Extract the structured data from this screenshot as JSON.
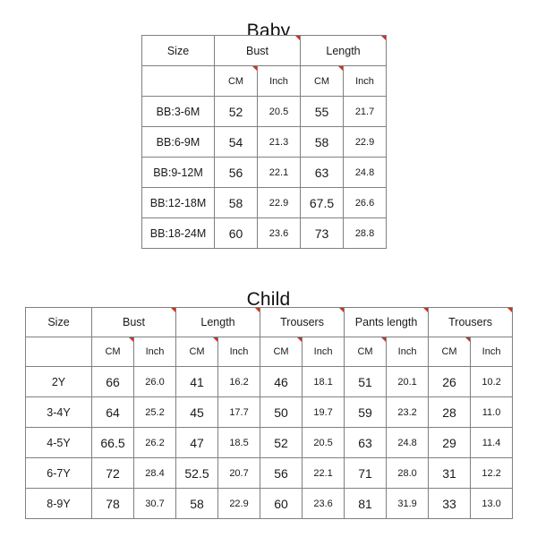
{
  "baby": {
    "title": "Baby",
    "header": {
      "size_label": "Size",
      "groups": [
        "Bust",
        "Length"
      ],
      "units": [
        "CM",
        "Inch",
        "CM",
        "Inch"
      ]
    },
    "rows": [
      {
        "size": "BB:3-6M",
        "cells": [
          "52",
          "20.5",
          "55",
          "21.7"
        ]
      },
      {
        "size": "BB:6-9M",
        "cells": [
          "54",
          "21.3",
          "58",
          "22.9"
        ]
      },
      {
        "size": "BB:9-12M",
        "cells": [
          "56",
          "22.1",
          "63",
          "24.8"
        ]
      },
      {
        "size": "BB:12-18M",
        "cells": [
          "58",
          "22.9",
          "67.5",
          "26.6"
        ]
      },
      {
        "size": "BB:18-24M",
        "cells": [
          "60",
          "23.6",
          "73",
          "28.8"
        ]
      }
    ]
  },
  "child": {
    "title": "Child",
    "header": {
      "size_label": "Size",
      "groups": [
        "Bust",
        "Length",
        "Trousers",
        "Pants length",
        "Trousers"
      ],
      "units": [
        "CM",
        "Inch",
        "CM",
        "Inch",
        "CM",
        "Inch",
        "CM",
        "Inch",
        "CM",
        "Inch"
      ]
    },
    "rows": [
      {
        "size": "2Y",
        "cells": [
          "66",
          "26.0",
          "41",
          "16.2",
          "46",
          "18.1",
          "51",
          "20.1",
          "26",
          "10.2"
        ]
      },
      {
        "size": "3-4Y",
        "cells": [
          "64",
          "25.2",
          "45",
          "17.7",
          "50",
          "19.7",
          "59",
          "23.2",
          "28",
          "11.0"
        ]
      },
      {
        "size": "4-5Y",
        "cells": [
          "66.5",
          "26.2",
          "47",
          "18.5",
          "52",
          "20.5",
          "63",
          "24.8",
          "29",
          "11.4"
        ]
      },
      {
        "size": "6-7Y",
        "cells": [
          "72",
          "28.4",
          "52.5",
          "20.7",
          "56",
          "22.1",
          "71",
          "28.0",
          "31",
          "12.2"
        ]
      },
      {
        "size": "8-9Y",
        "cells": [
          "78",
          "30.7",
          "58",
          "22.9",
          "60",
          "23.6",
          "81",
          "31.9",
          "33",
          "13.0"
        ]
      }
    ]
  },
  "colors": {
    "marker": "#c0392b",
    "border": "#808080",
    "text": "#1a1a1a",
    "background": "#ffffff"
  }
}
